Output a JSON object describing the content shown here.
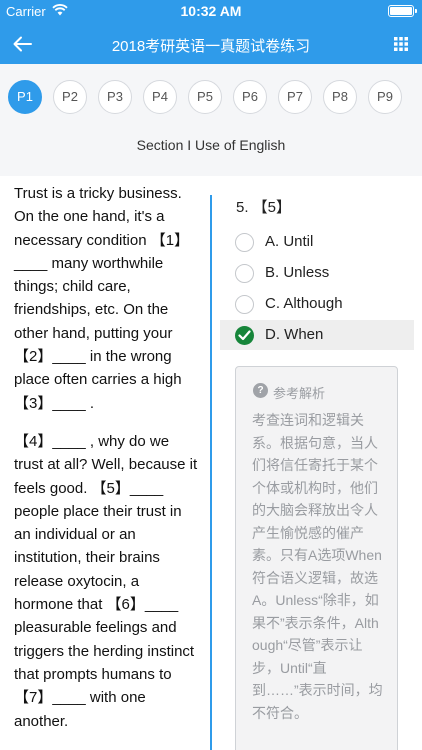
{
  "status_bar": {
    "carrier": "Carrier",
    "time": "10:32 AM"
  },
  "nav": {
    "title": "2018考研英语一真题试卷练习",
    "back_icon": "arrow-left-icon",
    "grid_icon": "grid-menu-icon"
  },
  "tabs": {
    "items": [
      "P1",
      "P2",
      "P3",
      "P4",
      "P5",
      "P6",
      "P7",
      "P8",
      "P9"
    ],
    "active_index": 0
  },
  "section_title": "Section I Use of English",
  "passage": {
    "paragraphs": [
      "Trust is a tricky business. On the one hand, it's a necessary condition 【1】____ many worthwhile things; child care, friendships, etc. On the other hand, putting your 【2】____ in the wrong place often carries a high 【3】____ .",
      "【4】____ , why do we trust at all? Well, because it feels good. 【5】____ people place their trust in an individual or an institution, their brains release oxytocin, a hormone that 【6】____ pleasurable feelings and triggers the herding instinct that prompts humans to 【7】____ with one another."
    ]
  },
  "question": {
    "title": "5. 【5】",
    "options": [
      {
        "label": "A. Until",
        "selected": false
      },
      {
        "label": "B. Unless",
        "selected": false
      },
      {
        "label": "C. Although",
        "selected": false
      },
      {
        "label": "D. When",
        "selected": true
      }
    ],
    "analysis_title": "参考解析",
    "analysis_text": "考查连词和逻辑关系。根据句意，当人们将信任寄托于某个个体或机构时，他们的大脑会释放出令人产生愉悦感的催产素。只有A选项When符合语义逻辑，故选A。Unless“除非，如果不”表示条件，Although“尽管”表示让步，Until“直到……”表示时间，均不符合。"
  },
  "colors": {
    "header": "#2f9bea",
    "active_tab": "#2f9bea",
    "check": "#16853a",
    "divider": "#2f9bea"
  }
}
